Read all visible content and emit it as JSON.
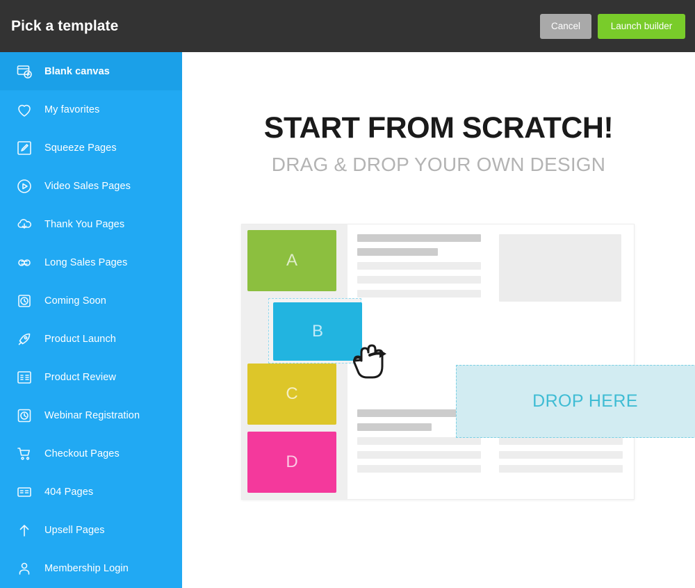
{
  "header": {
    "title": "Pick a template",
    "cancel_label": "Cancel",
    "launch_label": "Launch builder",
    "bg_color": "#333333",
    "cancel_color": "#a9a9a9",
    "launch_color": "#79cc2a"
  },
  "sidebar": {
    "bg_color": "#21a9f3",
    "active_bg_color": "#1ba0e8",
    "items": [
      {
        "label": "Blank canvas",
        "icon": "blank-canvas-icon",
        "active": true
      },
      {
        "label": "My favorites",
        "icon": "heart-icon",
        "active": false
      },
      {
        "label": "Squeeze Pages",
        "icon": "pencil-square-icon",
        "active": false
      },
      {
        "label": "Video Sales Pages",
        "icon": "play-circle-icon",
        "active": false
      },
      {
        "label": "Thank You Pages",
        "icon": "cloud-download-icon",
        "active": false
      },
      {
        "label": "Long Sales Pages",
        "icon": "infinity-icon",
        "active": false
      },
      {
        "label": "Coming Soon",
        "icon": "clock-icon",
        "active": false
      },
      {
        "label": "Product Launch",
        "icon": "rocket-icon",
        "active": false
      },
      {
        "label": "Product Review",
        "icon": "list-layout-icon",
        "active": false
      },
      {
        "label": "Webinar Registration",
        "icon": "webinar-clock-icon",
        "active": false
      },
      {
        "label": "Checkout Pages",
        "icon": "shopping-cart-icon",
        "active": false
      },
      {
        "label": "404 Pages",
        "icon": "broken-page-icon",
        "active": false
      },
      {
        "label": "Upsell Pages",
        "icon": "arrow-up-icon",
        "active": false
      },
      {
        "label": "Membership Login",
        "icon": "member-person-icon",
        "active": false
      }
    ]
  },
  "main": {
    "hero_title": "START FROM SCRATCH!",
    "hero_subtitle": "DRAG & DROP YOUR OWN DESIGN",
    "hero_title_color": "#1a1a1a",
    "hero_subtitle_color": "#b3b3b3"
  },
  "mockup": {
    "blocks": [
      {
        "letter": "A",
        "color": "#8cbf3f"
      },
      {
        "letter": "B",
        "color": "#22b4e0"
      },
      {
        "letter": "C",
        "color": "#ddc629"
      },
      {
        "letter": "D",
        "color": "#f4399c"
      }
    ],
    "drop_zone": {
      "label": "DROP HERE",
      "fill_color": "#d2ecf2",
      "border_color": "#79cfe3",
      "text_color": "#3fbcd4"
    },
    "dragging_block": "B",
    "placeholder_bar_dark": "#cccccc",
    "placeholder_bar_light": "#ededed",
    "image_box_color": "#ececec"
  }
}
